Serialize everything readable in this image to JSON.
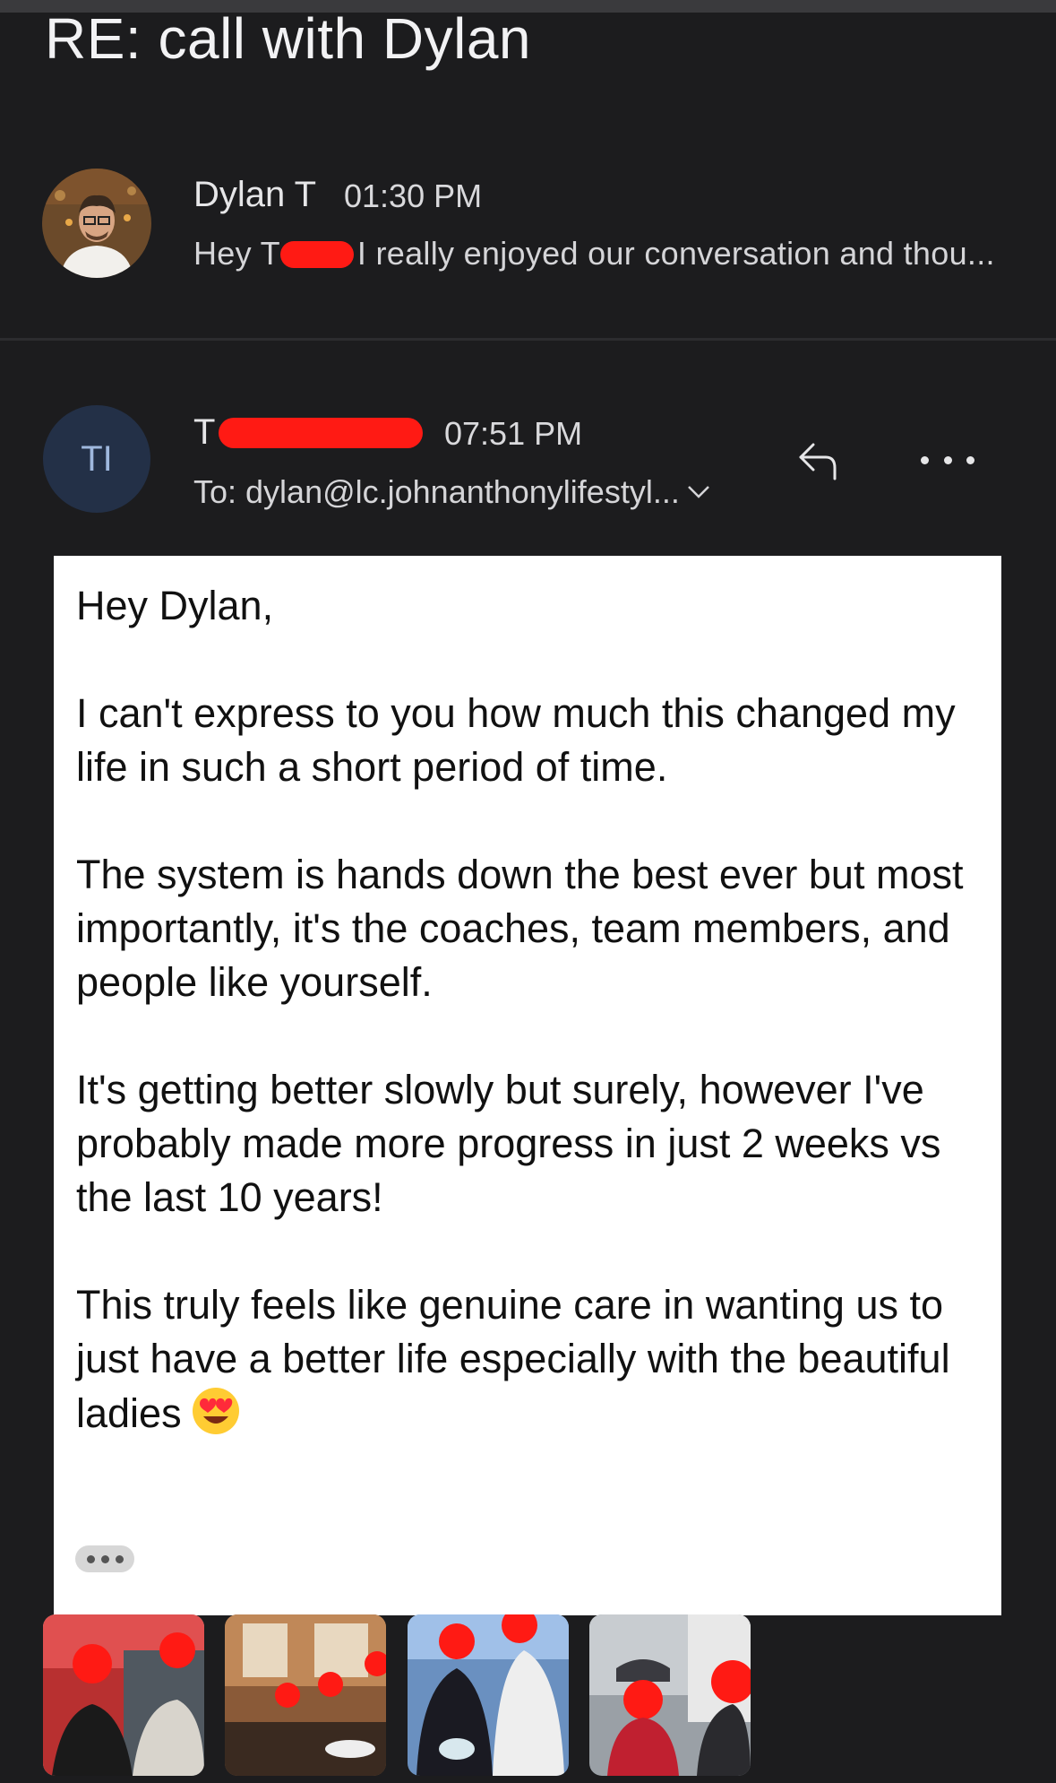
{
  "thread": {
    "subject": "RE: call with Dylan"
  },
  "message1": {
    "sender": "Dylan T",
    "time": "01:30 PM",
    "preview_start": "Hey T",
    "preview_rest": "I really enjoyed our conversation and thou..."
  },
  "message2": {
    "avatar_initials": "TI",
    "sender_start": "T",
    "time": "07:51 PM",
    "to": "To: dylan@lc.johnanthonylifestyl...",
    "body": {
      "greeting": "Hey Dylan,",
      "p1": "I can't express to you how much this changed my life in such a short period of time.",
      "p2": "The system is hands down the best ever but most importantly, it's the coaches, team members, and people like yourself.",
      "p3": "It's getting better slowly but surely, however I've probably made more progress in just 2 weeks vs the last 10 years!",
      "p4": "This truly feels like genuine care in wanting us to just have a better life especially with the beautiful ladies"
    },
    "emoji_icon": "heart-eyes-emoji",
    "attachments": [
      {
        "name": "photo-1"
      },
      {
        "name": "photo-2"
      },
      {
        "name": "photo-3"
      },
      {
        "name": "photo-4"
      }
    ]
  },
  "colors": {
    "background": "#1c1c1e",
    "redaction": "#ff1a14",
    "avatar_bg": "#233047",
    "card": "#ffffff"
  }
}
